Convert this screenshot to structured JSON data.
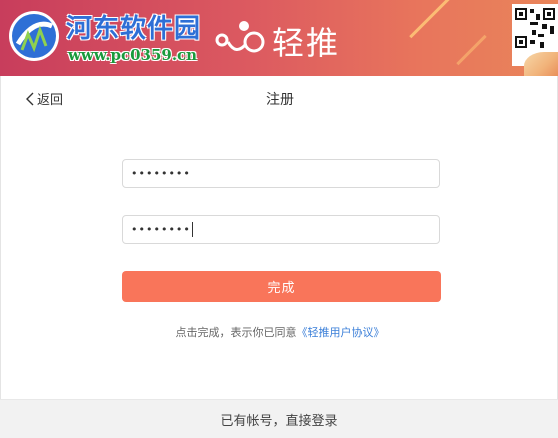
{
  "banner": {
    "site_name": "河东软件园",
    "site_url": "www.pc0359.cn",
    "app_name": "轻推",
    "accent": "#f9755a"
  },
  "nav": {
    "back_label": "返回",
    "title": "注册"
  },
  "form": {
    "password_value": "••••••••",
    "confirm_value": "••••••••",
    "submit_label": "完成"
  },
  "agreement": {
    "prefix": "点击完成，表示你已同意",
    "link": "《轻推用户协议》"
  },
  "footer": {
    "login_link": "已有帐号，直接登录"
  }
}
